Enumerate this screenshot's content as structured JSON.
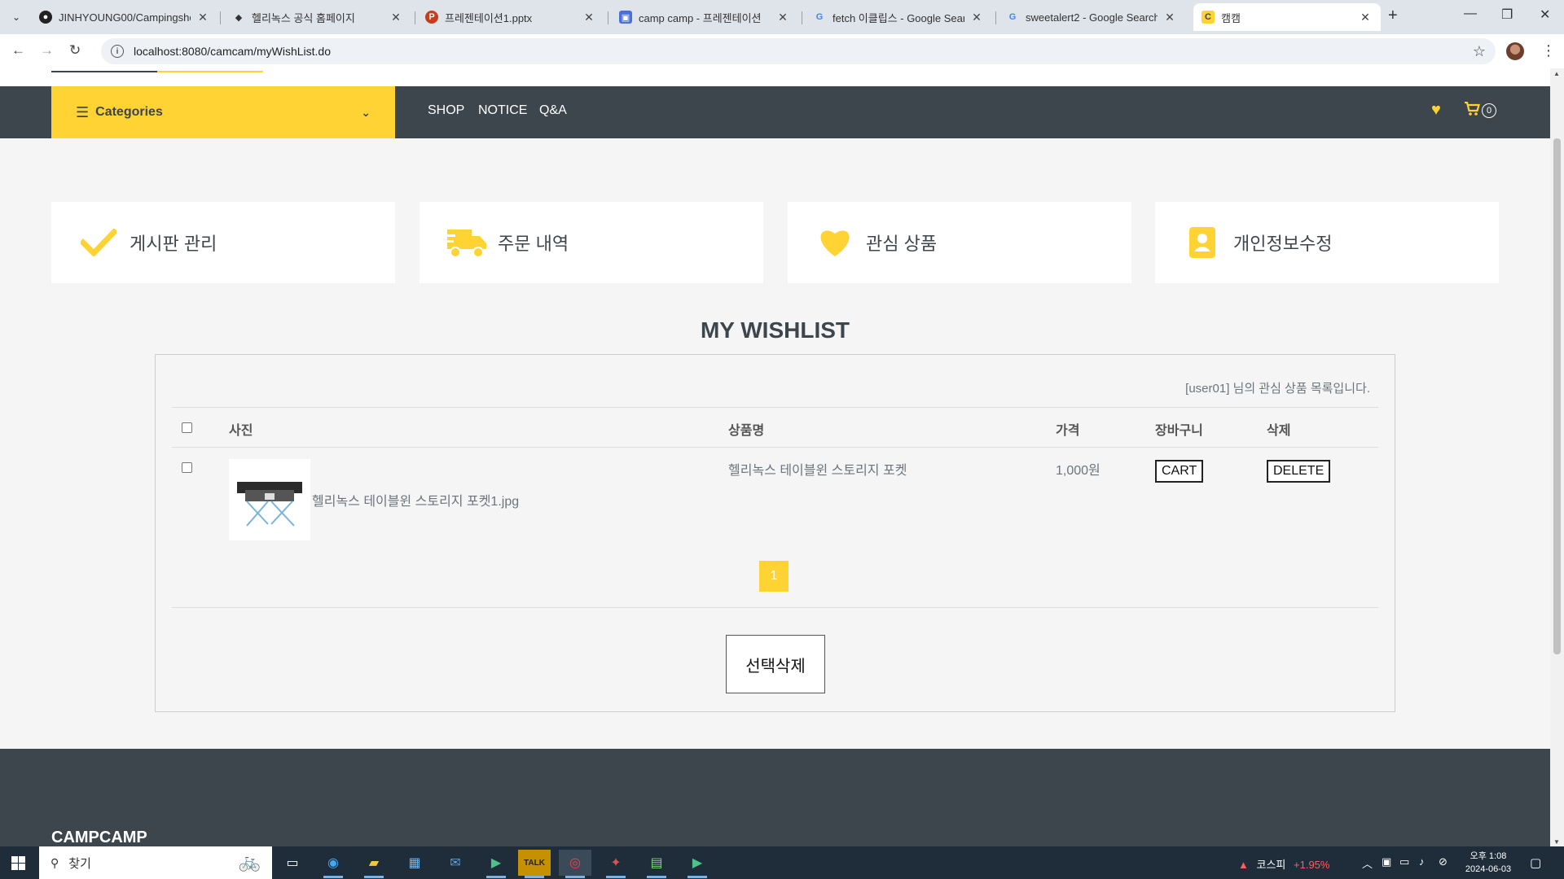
{
  "browser": {
    "tabs": [
      {
        "title": "JINHYOUNG00/Campingshop",
        "favicon": "github-icon"
      },
      {
        "title": "헬리녹스 공식 홈페이지",
        "favicon": "diamond-icon"
      },
      {
        "title": "프레젠테이션1.pptx",
        "favicon": "powerpoint-icon"
      },
      {
        "title": "camp camp - 프레젠테이션",
        "favicon": "slides-icon"
      },
      {
        "title": "fetch 이클립스 - Google Searc",
        "favicon": "google-icon"
      },
      {
        "title": "sweetalert2 - Google Search",
        "favicon": "google-icon"
      },
      {
        "title": "캠캠",
        "favicon": "camcam-icon",
        "active": true
      }
    ],
    "url": "localhost:8080/camcam/myWishList.do"
  },
  "navbar": {
    "categories_label": "Categories",
    "links": [
      "SHOP",
      "NOTICE",
      "Q&A"
    ],
    "cart_count": "0"
  },
  "cards": [
    {
      "label": "게시판 관리",
      "icon": "check-icon"
    },
    {
      "label": "주문 내역",
      "icon": "truck-icon"
    },
    {
      "label": "관심 상품",
      "icon": "heart-icon"
    },
    {
      "label": "개인정보수정",
      "icon": "user-card-icon"
    }
  ],
  "wishlist": {
    "title": "MY WISHLIST",
    "notice": "[user01] 님의 관심 상품 목록입니다.",
    "headers": {
      "photo": "사진",
      "name": "상품명",
      "price": "가격",
      "cart": "장바구니",
      "delete": "삭제"
    },
    "items": [
      {
        "image_filename": "헬리녹스 테이블윈 스토리지 포켓1.jpg",
        "name": "헬리녹스 테이블윈 스토리지 포켓",
        "price": "1,000원",
        "cart_label": "CART",
        "delete_label": "DELETE"
      }
    ],
    "page": "1",
    "delete_selected_label": "선택삭제"
  },
  "footer": {
    "brand": "CAMPCAMP"
  },
  "taskbar": {
    "search_placeholder": "찾기",
    "kospi_label": "코스피",
    "kospi_change": "+1.95%",
    "time": "오후 1:08",
    "date": "2024-06-03"
  },
  "colors": {
    "accent": "#ffd333",
    "dark": "#3d464d",
    "background": "#f5f5f5"
  }
}
